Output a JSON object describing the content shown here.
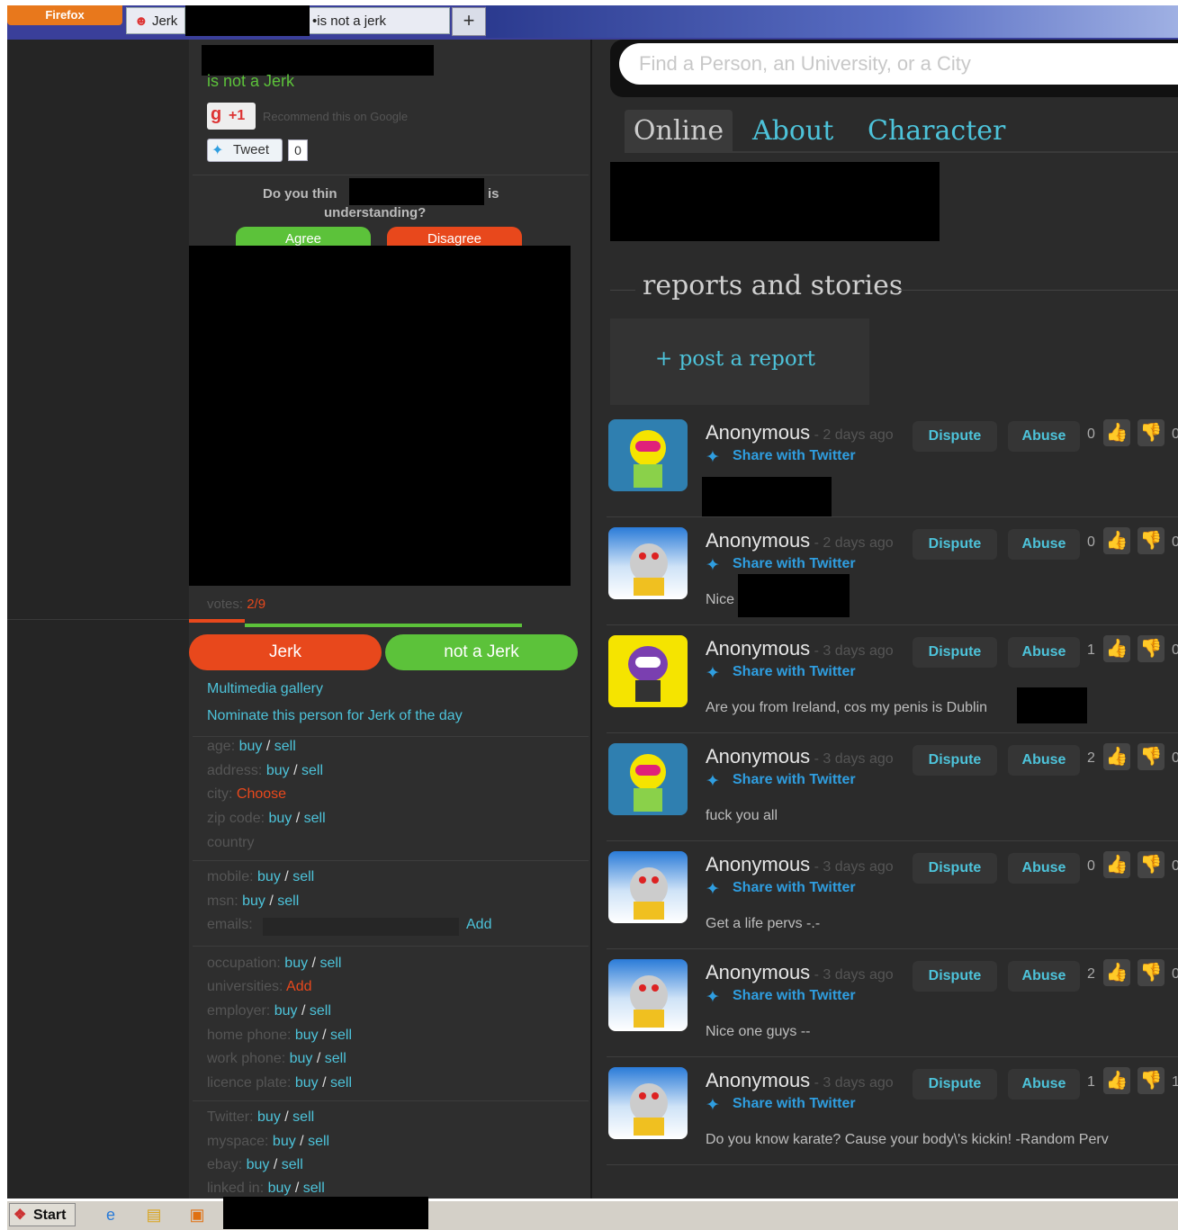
{
  "browser": {
    "menu_button": "Firefox",
    "tab1_label": "Jerk",
    "tab2_label": "is not a jerk",
    "new_tab": "+"
  },
  "left": {
    "heading": "is not a Jerk",
    "gplus_label": "+1",
    "gplus_text": "Recommend this on Google",
    "tweet_label": "Tweet",
    "tweet_count": "0",
    "question_start": "Do you thin",
    "question_end": "is",
    "question_line2": "understanding?",
    "agree": "Agree",
    "disagree": "Disagree",
    "votes_label": "votes:",
    "votes_value": "2/9",
    "vote_jerk": "Jerk",
    "vote_notjerk": "not a Jerk",
    "links": [
      "Multimedia gallery",
      "Nominate this person for Jerk of the day"
    ],
    "buy": "buy",
    "slash": "/",
    "sell": "sell",
    "choose": "Choose",
    "add": "Add",
    "fields": {
      "age": "age:",
      "address": "address:",
      "city": "city:",
      "zip": "zip code:",
      "country": "country",
      "mobile": "mobile:",
      "msn": "msn:",
      "emails": "emails:",
      "occupation": "occupation:",
      "universities": "universities:",
      "employer": "employer:",
      "home_phone": "home phone:",
      "work_phone": "work phone:",
      "licence_plate": "licence plate:",
      "twitter": "Twitter:",
      "myspace": "myspace:",
      "ebay": "ebay:",
      "linkedin": "linked in:"
    }
  },
  "right": {
    "search_placeholder": "Find a Person, an University, or a City",
    "tabs": [
      "Online",
      "About",
      "Character"
    ],
    "section_title": "reports and stories",
    "post_report": "+ post a report",
    "dispute": "Dispute",
    "abuse": "Abuse",
    "share": "Share with Twitter",
    "posts": [
      {
        "author": "Anonymous",
        "ago": " - 2 days ago",
        "up": "0",
        "down": "0",
        "comment": "",
        "avatar": "kid-blue"
      },
      {
        "author": "Anonymous",
        "ago": " - 2 days ago",
        "up": "0",
        "down": "0",
        "comment": "Nice",
        "avatar": "snow"
      },
      {
        "author": "Anonymous",
        "ago": " - 3 days ago",
        "up": "1",
        "down": "0",
        "comment": "Are you from Ireland, cos my penis is Dublin",
        "avatar": "kid-yellow"
      },
      {
        "author": "Anonymous",
        "ago": " - 3 days ago",
        "up": "2",
        "down": "0",
        "comment": "fuck you all",
        "avatar": "kid-blue"
      },
      {
        "author": "Anonymous",
        "ago": " - 3 days ago",
        "up": "0",
        "down": "0",
        "comment": "Get a life pervs -.-",
        "avatar": "snow"
      },
      {
        "author": "Anonymous",
        "ago": " - 3 days ago",
        "up": "2",
        "down": "0",
        "comment": "Nice one guys --",
        "avatar": "snow"
      },
      {
        "author": "Anonymous",
        "ago": " - 3 days ago",
        "up": "1",
        "down": "1",
        "comment": "Do you know karate? Cause your body\\'s kickin! -Random Perv",
        "avatar": "snow"
      }
    ]
  },
  "taskbar": {
    "start": "Start"
  },
  "colors": {
    "link": "#4dc3da",
    "jerk": "#e8481c",
    "not_jerk": "#5cc23a",
    "alert": "#e8481c",
    "twitter": "#2f9ee0"
  }
}
